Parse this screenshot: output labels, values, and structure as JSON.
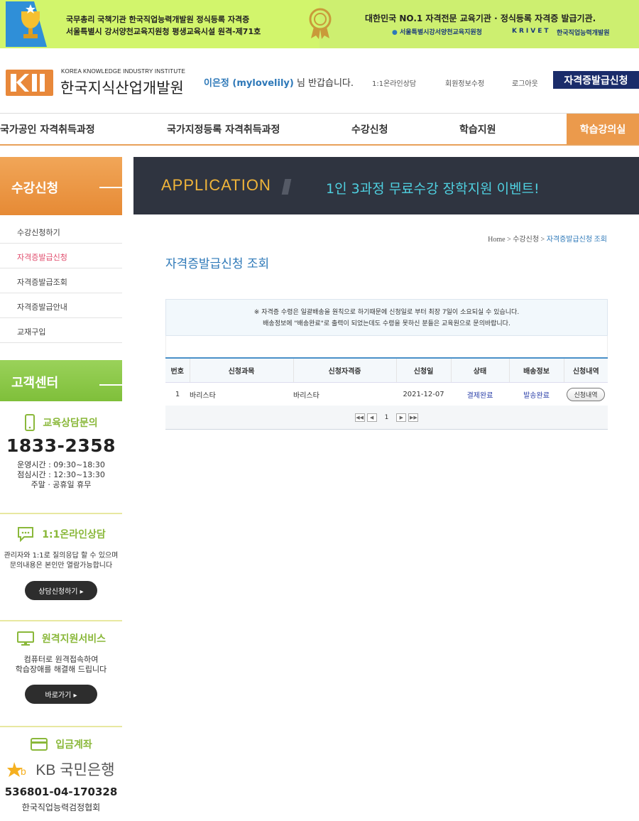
{
  "banner": {
    "left_line1": "국무총리 국책기관 한국직업능력개발원 정식등록 자격증",
    "left_line2": "서울특별시 강서양천교육지원청 평생교육시설 원격-제71호",
    "right_line1": "대한민국 NO.1 자격전문 교육기관 · 정식등록 자격증 발급기관.",
    "right_seal": "서울특별시강서양천교육지원청",
    "right_krivet": "KRIVET",
    "right_krivet_name": "한국직업능력개발원"
  },
  "header": {
    "logo_mark": "KKII",
    "logo_en": "KOREA KNOWLEDGE INDUSTRY INSTITUTE",
    "logo_ko": "한국지식산업개발원",
    "user": "이은정 (mylovelily)",
    "greet_suffix": " 님 반갑습니다.",
    "links": [
      "1:1온라인상담",
      "회원정보수정",
      "로그아웃"
    ],
    "cert_button": "자격증발급신청"
  },
  "gnb": [
    "국가공인 자격취득과정",
    "국가지정등록 자격취득과정",
    "수강신청",
    "학습지원",
    "학습강의실"
  ],
  "side": {
    "title": "수강신청",
    "menu": [
      "수강신청하기",
      "자격증발급신청",
      "자격증발급조회",
      "자격증발급안내",
      "교재구입"
    ],
    "cs_title": "고객센터",
    "edu": {
      "title": "교육상담문의",
      "tel": "1833-2358",
      "hours1": "운영시간 : 09:30~18:30",
      "hours2": "점심시간 : 12:30~13:30",
      "hours3": "주말 · 공휴일 휴무"
    },
    "online": {
      "title": "1:1온라인상담",
      "desc1": "관리자와 1:1로 질의응답 할 수 있으며",
      "desc2": "문의내용은 본인만 열람가능합니다",
      "button": "상담신청하기 ▸"
    },
    "remote": {
      "title": "원격지원서비스",
      "desc1": "컴퓨터로 원격접속하여",
      "desc2": "학습장애를 해결해 드립니다",
      "button": "바로가기 ▸"
    },
    "bank": {
      "title": "입금계좌",
      "bank_name": "KB 국민은행",
      "account": "536801-04-170328",
      "owner": "한국직업능력검정협회"
    }
  },
  "visual": {
    "en": "APPLICATION",
    "ko": "1인 3과정 무료수강 장학지원 이벤트!"
  },
  "breadcrumb": {
    "home": "Home",
    "sep": " > ",
    "level1": "수강신청",
    "current": "자격증발급신청 조회"
  },
  "page_title": "자격증발급신청 조회",
  "notice": {
    "line1": "※ 자격증 수령은 일괄배송을 원칙으로 하기때문에 신청일로 부터 최장 7일이 소요되실 수 있습니다.",
    "line2": "배송정보에 \"배송완료\"로 출력이 되었는데도 수령을 못하신 분들은 교육원으로 문의바랍니다."
  },
  "table": {
    "headers": [
      "번호",
      "신청과목",
      "신청자격증",
      "신청일",
      "상태",
      "배송정보",
      "신청내역"
    ],
    "rows": [
      {
        "no": "1",
        "subject": "바리스타",
        "cert": "바리스타",
        "date": "2021-12-07",
        "status": "결제완료",
        "delivery": "발송완료",
        "detail": "신청내역"
      }
    ]
  },
  "pager": {
    "first": "◀◀",
    "prev": "◀",
    "page": "1",
    "next": "▶",
    "last": "▶▶"
  },
  "colors": {
    "orange": "#eb9a4c",
    "green": "#8ab83a",
    "blue": "#2d78b8",
    "navy": "#1a2c6a"
  }
}
